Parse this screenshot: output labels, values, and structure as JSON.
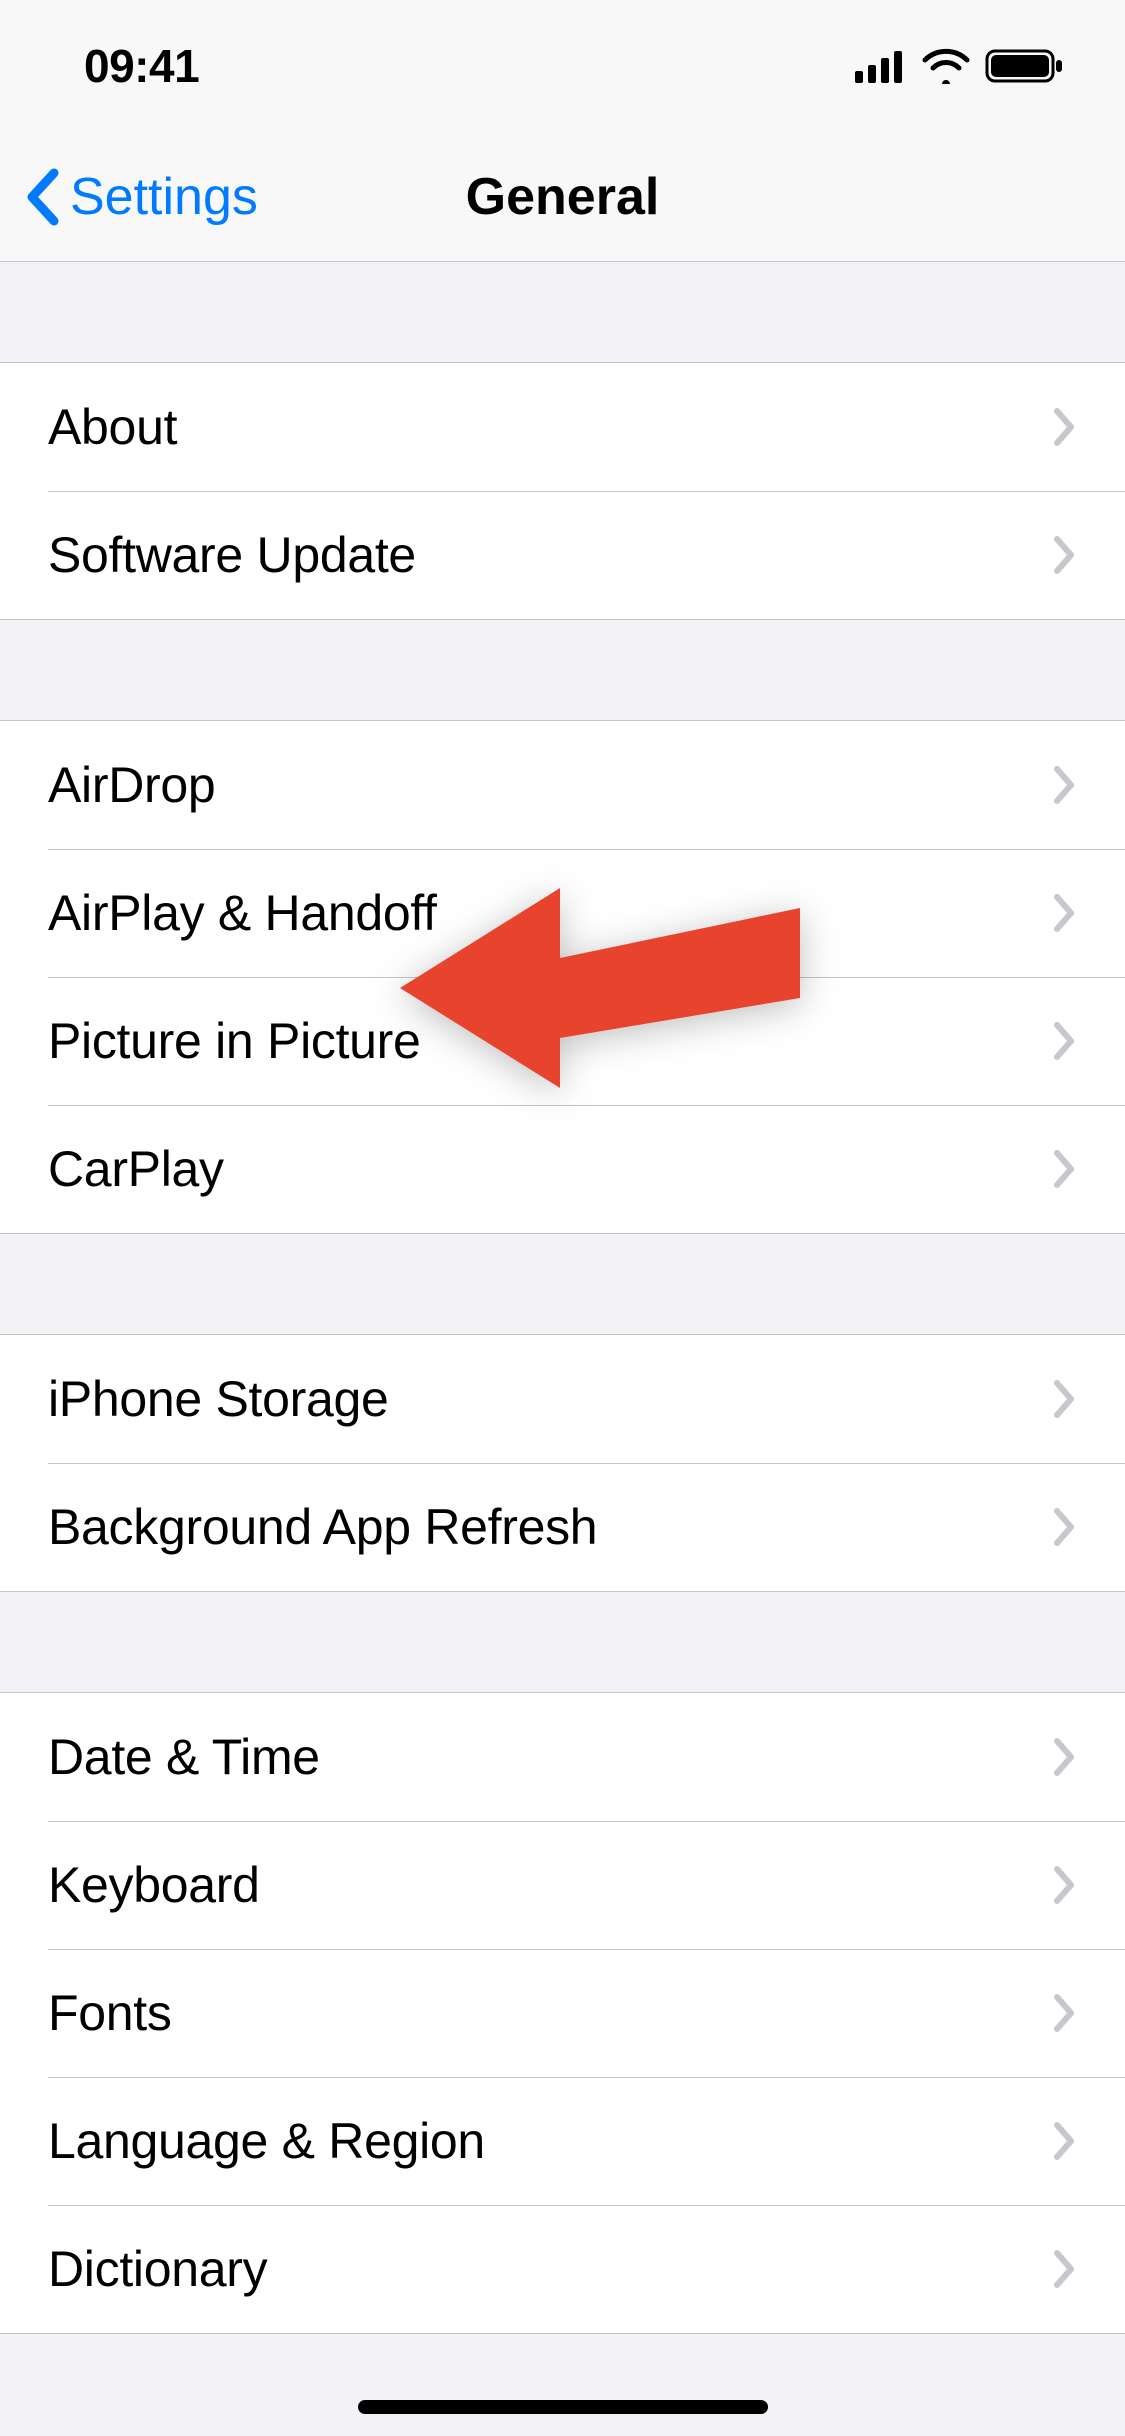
{
  "status_bar": {
    "time": "09:41"
  },
  "nav": {
    "back_label": "Settings",
    "title": "General"
  },
  "groups": [
    {
      "items": [
        {
          "key": "about",
          "label": "About"
        },
        {
          "key": "software-update",
          "label": "Software Update"
        }
      ]
    },
    {
      "items": [
        {
          "key": "airdrop",
          "label": "AirDrop"
        },
        {
          "key": "airplay-handoff",
          "label": "AirPlay & Handoff"
        },
        {
          "key": "picture-in-picture",
          "label": "Picture in Picture"
        },
        {
          "key": "carplay",
          "label": "CarPlay"
        }
      ]
    },
    {
      "items": [
        {
          "key": "iphone-storage",
          "label": "iPhone Storage"
        },
        {
          "key": "background-app-refresh",
          "label": "Background App Refresh"
        }
      ]
    },
    {
      "items": [
        {
          "key": "date-time",
          "label": "Date & Time"
        },
        {
          "key": "keyboard",
          "label": "Keyboard"
        },
        {
          "key": "fonts",
          "label": "Fonts"
        },
        {
          "key": "language-region",
          "label": "Language & Region"
        },
        {
          "key": "dictionary",
          "label": "Dictionary"
        }
      ]
    }
  ],
  "annotation": {
    "target": "picture-in-picture",
    "color": "#e74c3c"
  }
}
